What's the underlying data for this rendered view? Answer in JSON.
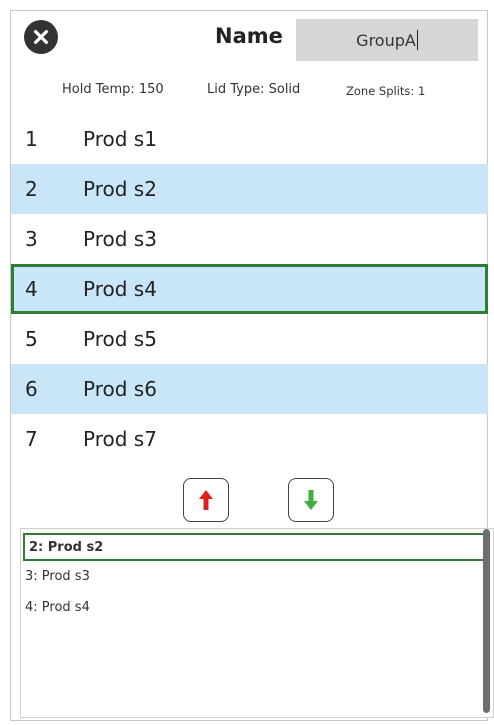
{
  "header": {
    "name_label": "Name",
    "name_value": "GroupA",
    "hold_temp": "Hold Temp: 150",
    "lid_type": "Lid Type: Solid",
    "zone_splits": "Zone Splits: 1"
  },
  "products": [
    {
      "num": "1",
      "label": "Prod s1"
    },
    {
      "num": "2",
      "label": "Prod s2"
    },
    {
      "num": "3",
      "label": "Prod s3"
    },
    {
      "num": "4",
      "label": "Prod s4"
    },
    {
      "num": "5",
      "label": "Prod s5"
    },
    {
      "num": "6",
      "label": "Prod s6"
    },
    {
      "num": "7",
      "label": "Prod s7"
    }
  ],
  "selected_row": "4",
  "sequence": [
    "2: Prod s2",
    "3: Prod s3",
    "4: Prod s4"
  ],
  "icons": {
    "close": "close-icon",
    "up": "arrow-up-icon",
    "down": "arrow-down-icon"
  },
  "colors": {
    "highlight": "#c8e6f7",
    "selection_border": "#2e7d32",
    "up_arrow": "#e02020",
    "down_arrow": "#3fae3f",
    "name_field_bg": "#d6d6d6"
  }
}
